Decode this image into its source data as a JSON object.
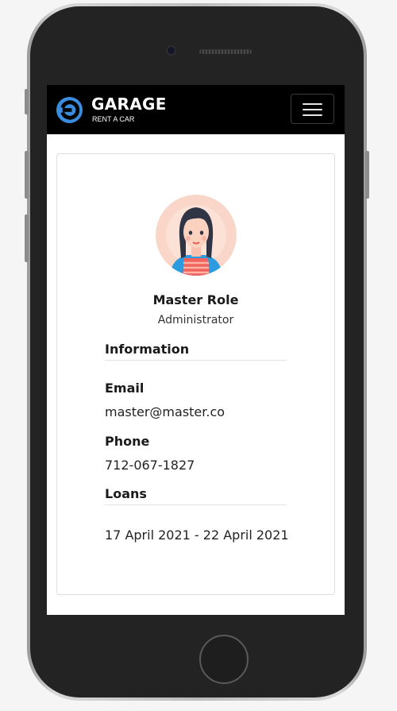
{
  "brand": {
    "name": "GARAGE",
    "tagline": "RENT A CAR",
    "accent_color": "#3a8dde"
  },
  "navbar": {
    "menu_icon": "hamburger-menu-icon"
  },
  "profile": {
    "avatar_icon": "user-avatar-icon",
    "name": "Master Role",
    "role": "Administrator"
  },
  "information": {
    "title": "Information",
    "email_label": "Email",
    "email_value": "master@master.co",
    "phone_label": "Phone",
    "phone_value": "712-067-1827"
  },
  "loans": {
    "title": "Loans",
    "items": [
      "17 April 2021 - 22 April 2021"
    ]
  }
}
